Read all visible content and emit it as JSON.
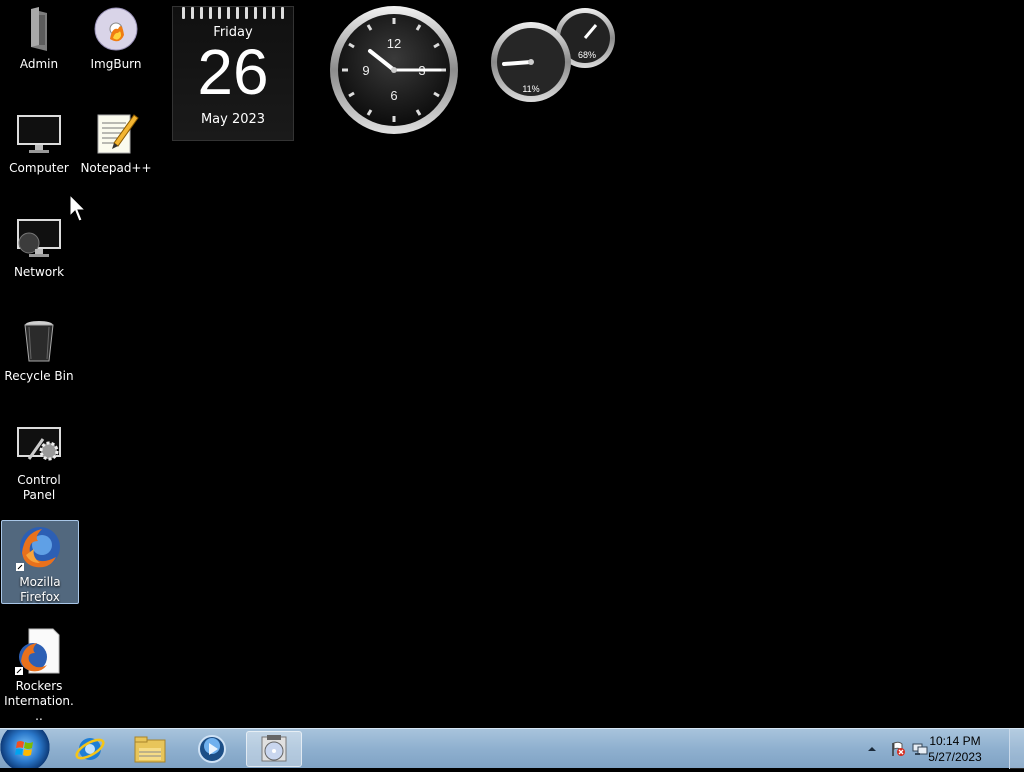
{
  "desktop_icons": [
    {
      "label": "Admin"
    },
    {
      "label": "ImgBurn"
    },
    {
      "label": "Computer"
    },
    {
      "label": "Notepad++"
    },
    {
      "label": "Network"
    },
    {
      "label": "Recycle Bin"
    },
    {
      "label": "Control Panel"
    },
    {
      "label": "Mozilla Firefox"
    },
    {
      "label": "Rockers Internation..."
    }
  ],
  "calendar_gadget": {
    "weekday": "Friday",
    "day": "26",
    "month_year": "May 2023"
  },
  "clock_gadget": {
    "numerals": [
      "12",
      "3",
      "6",
      "9"
    ]
  },
  "cpu_meter_gadget": {
    "cpu": "11%",
    "memory": "68%"
  },
  "taskbar": {
    "pinned": [
      {
        "icon": "internet-explorer-icon"
      },
      {
        "icon": "windows-explorer-icon"
      },
      {
        "icon": "windows-media-player-icon"
      },
      {
        "icon": "imgburn-icon"
      }
    ],
    "tray": {
      "time": "10:14 PM",
      "date": "5/27/2023"
    }
  },
  "colors": {
    "desktop": "#000000",
    "taskbar": "#9fbcd8",
    "selection": "#96bee6"
  }
}
